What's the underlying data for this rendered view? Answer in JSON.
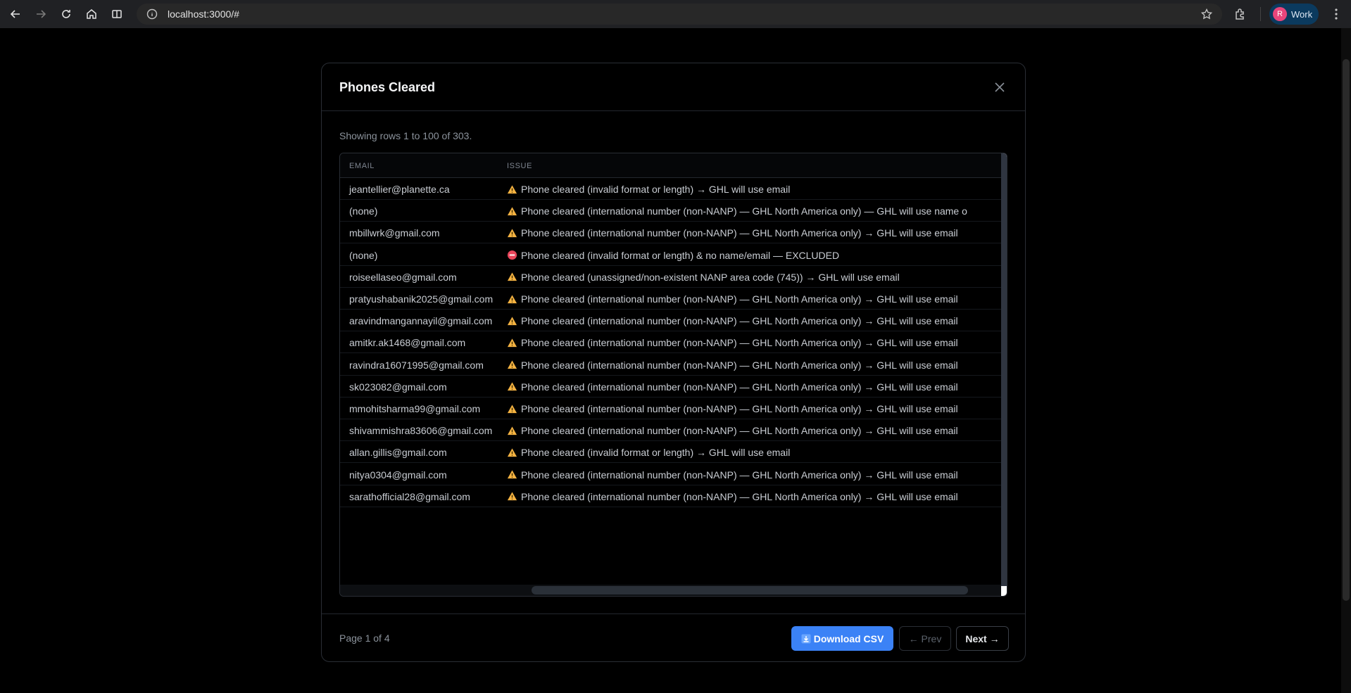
{
  "browser": {
    "url": "localhost:3000/#",
    "profile_initial": "R",
    "profile_name": "Work"
  },
  "modal": {
    "title": "Phones Cleared",
    "showing_text": "Showing rows 1 to 100 of 303.",
    "columns": [
      "EMAIL",
      "ISSUE"
    ],
    "rows": [
      {
        "email": "jeantellier@planette.ca",
        "icon": "warning-icon",
        "issue": "Phone cleared (invalid format or length) → GHL will use email"
      },
      {
        "email": "(none)",
        "icon": "warning-icon",
        "issue": "Phone cleared (international number (non-NANP) — GHL North America only) — GHL will use name o"
      },
      {
        "email": "mbillwrk@gmail.com",
        "icon": "warning-icon",
        "issue": "Phone cleared (international number (non-NANP) — GHL North America only) → GHL will use email"
      },
      {
        "email": "(none)",
        "icon": "excluded-icon",
        "issue": "Phone cleared (invalid format or length) & no name/email — EXCLUDED"
      },
      {
        "email": "roiseellaseo@gmail.com",
        "icon": "warning-icon",
        "issue": "Phone cleared (unassigned/non-existent NANP area code (745)) → GHL will use email"
      },
      {
        "email": "pratyushabanik2025@gmail.com",
        "icon": "warning-icon",
        "issue": "Phone cleared (international number (non-NANP) — GHL North America only) → GHL will use email"
      },
      {
        "email": "aravindmangannayil@gmail.com",
        "icon": "warning-icon",
        "issue": "Phone cleared (international number (non-NANP) — GHL North America only) → GHL will use email"
      },
      {
        "email": "amitkr.ak1468@gmail.com",
        "icon": "warning-icon",
        "issue": "Phone cleared (international number (non-NANP) — GHL North America only) → GHL will use email"
      },
      {
        "email": "ravindra16071995@gmail.com",
        "icon": "warning-icon",
        "issue": "Phone cleared (international number (non-NANP) — GHL North America only) → GHL will use email"
      },
      {
        "email": "sk023082@gmail.com",
        "icon": "warning-icon",
        "issue": "Phone cleared (international number (non-NANP) — GHL North America only) → GHL will use email"
      },
      {
        "email": "mmohitsharma99@gmail.com",
        "icon": "warning-icon",
        "issue": "Phone cleared (international number (non-NANP) — GHL North America only) → GHL will use email"
      },
      {
        "email": "shivammishra83606@gmail.com",
        "icon": "warning-icon",
        "issue": "Phone cleared (international number (non-NANP) — GHL North America only) → GHL will use email"
      },
      {
        "email": "allan.gillis@gmail.com",
        "icon": "warning-icon",
        "issue": "Phone cleared (invalid format or length) → GHL will use email"
      },
      {
        "email": "nitya0304@gmail.com",
        "icon": "warning-icon",
        "issue": "Phone cleared (international number (non-NANP) — GHL North America only) → GHL will use email"
      },
      {
        "email": "sarathofficial28@gmail.com",
        "icon": "warning-icon",
        "issue": "Phone cleared (international number (non-NANP) — GHL North America only) → GHL will use email"
      }
    ],
    "page_info": "Page 1 of 4",
    "download_label": "Download CSV",
    "prev_label": "← Prev",
    "next_label": "Next →"
  },
  "colors": {
    "accent": "#3b82f6",
    "warning": "#f5b342",
    "excluded": "#e8455a"
  }
}
